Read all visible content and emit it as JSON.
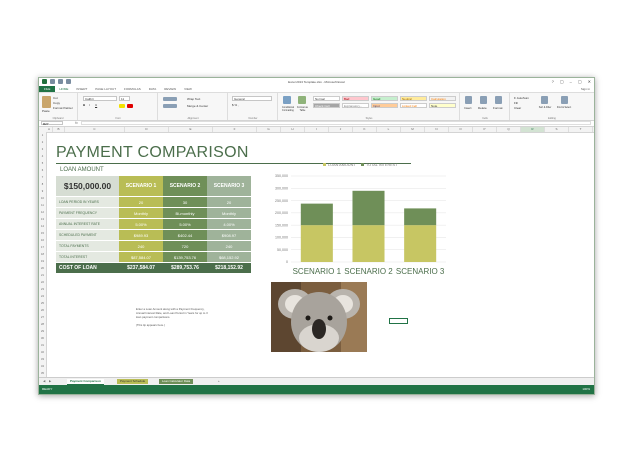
{
  "window": {
    "title": "Excel 2013 Template.xlsx - Microsoft Excel",
    "controls": [
      "?",
      "▢",
      "–",
      "▢",
      "✕"
    ],
    "signin": "Sign in"
  },
  "ribbon_tabs": [
    "FILE",
    "HOME",
    "INSERT",
    "PAGE LAYOUT",
    "FORMULAS",
    "DATA",
    "REVIEW",
    "VIEW"
  ],
  "ribbon": {
    "clipboard": {
      "cut": "Cut",
      "copy": "Copy",
      "painter": "Format Painter",
      "paste": "Paste",
      "label": "Clipboard"
    },
    "font": {
      "name": "Calibri",
      "size": "11",
      "label": "Font"
    },
    "alignment": {
      "wrap": "Wrap Text",
      "merge": "Merge & Center",
      "label": "Alignment"
    },
    "number": {
      "format": "General",
      "label": "Number"
    },
    "styles": {
      "conditional": "Conditional Formatting",
      "format_table": "Format as Table",
      "cells": [
        {
          "label": "Normal",
          "bg": "#ffffff",
          "color": "#333333"
        },
        {
          "label": "Bad",
          "bg": "#ffc7ce",
          "color": "#9c0006"
        },
        {
          "label": "Good",
          "bg": "#c6efce",
          "color": "#006100"
        },
        {
          "label": "Neutral",
          "bg": "#ffeb9c",
          "color": "#9c6500"
        },
        {
          "label": "Calculation",
          "bg": "#f2f2f2",
          "color": "#fa7d00"
        },
        {
          "label": "Check Cell",
          "bg": "#a5a5a5",
          "color": "#ffffff"
        },
        {
          "label": "Explanatory...",
          "bg": "#ffffff",
          "color": "#7f7f7f"
        },
        {
          "label": "Input",
          "bg": "#ffcc99",
          "color": "#3f3f76"
        },
        {
          "label": "Linked Cell",
          "bg": "#ffffff",
          "color": "#fa7d00"
        },
        {
          "label": "Note",
          "bg": "#ffffcc",
          "color": "#333333"
        }
      ],
      "label": "Styles"
    },
    "cells": {
      "insert": "Insert",
      "delete": "Delete",
      "format": "Format",
      "label": "Cells"
    },
    "editing": {
      "autosum": "AutoSum",
      "fill": "Fill",
      "clear": "Clear",
      "sort": "Sort & Filter",
      "find": "Find & Select",
      "label": "Editing"
    }
  },
  "formula_bar": {
    "namebox": "R27",
    "fx": "fx",
    "value": ""
  },
  "columns": [
    "A",
    "B",
    "C",
    "D",
    "E",
    "F",
    "G",
    "H",
    "I",
    "J",
    "K",
    "L",
    "M",
    "N",
    "O",
    "P",
    "Q",
    "R",
    "S",
    "T",
    "U"
  ],
  "rows": [
    "1",
    "2",
    "3",
    "4",
    "5",
    "6",
    "7",
    "8",
    "9",
    "10",
    "11",
    "12",
    "13",
    "14",
    "15",
    "16",
    "17",
    "18",
    "19",
    "20",
    "21",
    "22",
    "23",
    "24",
    "25",
    "26",
    "27",
    "28",
    "29",
    "30",
    "31",
    "32",
    "33",
    "34",
    "35"
  ],
  "sheet": {
    "title": "PAYMENT COMPARISON",
    "loan_label": "LOAN AMOUNT",
    "loan_amount": "$150,000.00",
    "scenarios": [
      "SCENARIO 1",
      "SCENARIO 2",
      "SCENARIO 3"
    ],
    "rows": [
      {
        "label": "LOAN PERIOD IN YEARS",
        "values": [
          "20",
          "30",
          "20"
        ]
      },
      {
        "label": "PAYMENT FREQUENCY",
        "values": [
          "Monthly",
          "Bi-monthly",
          "Monthly"
        ]
      },
      {
        "label": "ANNUAL INTEREST RATE",
        "values": [
          "5.00%",
          "5.00%",
          "4.00%"
        ]
      },
      {
        "label": "SCHEDULED PAYMENT",
        "values": [
          "$989.93",
          "$402.44",
          "$908.97"
        ]
      },
      {
        "label": "TOTAL PAYMENTS",
        "values": [
          "240",
          "720",
          "240"
        ]
      },
      {
        "label": "TOTAL INTEREST",
        "values": [
          "$87,584.07",
          "$139,753.76",
          "$68,152.92"
        ]
      }
    ],
    "total": {
      "label": "COST OF LOAN",
      "values": [
        "$237,584.07",
        "$289,753.76",
        "$218,152.92"
      ]
    },
    "note_lines": [
      "Enter a Loan Amount along with a Payment Frequency,",
      "Annual Interest Rate, and Loan Period in Years for up to 3",
      "loan payment comparisons.",
      "",
      "(This tip appears here.)"
    ]
  },
  "chart_data": {
    "type": "bar",
    "stacked": true,
    "categories": [
      "SCENARIO 1",
      "SCENARIO 2",
      "SCENARIO 3"
    ],
    "series": [
      {
        "name": "LOAN AMOUNT",
        "values": [
          150000,
          150000,
          150000
        ],
        "color": "#c7c663"
      },
      {
        "name": "TOTAL INTEREST",
        "values": [
          87584.07,
          139753.76,
          68152.92
        ],
        "color": "#6f8f58"
      }
    ],
    "yticks": [
      "350,000",
      "300,000",
      "250,000",
      "200,000",
      "150,000",
      "100,000",
      "50,000",
      "0"
    ],
    "ylim": [
      0,
      350000
    ],
    "grid": true,
    "legend": "top"
  },
  "sheet_tabs": [
    "Payment Comparison",
    "Payment Schedule",
    "Loan Calculator Data"
  ],
  "add_sheet": "+",
  "status": {
    "left": "READY",
    "zoom": "100%"
  },
  "colors": {
    "excel_green": "#217346",
    "accent": "#4b6e4b"
  }
}
